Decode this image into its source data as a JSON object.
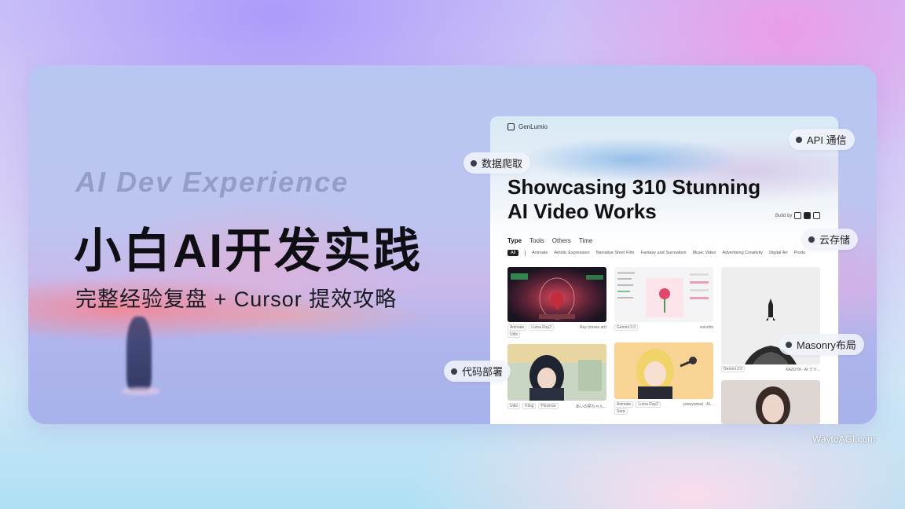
{
  "banner": {
    "eyebrow": "AI Dev Experience",
    "title": "小白AI开发实践",
    "subtitle": "完整经验复盘 + Cursor 提效攻略"
  },
  "screenshot": {
    "brand": "GenLumio",
    "title_line1": "Showcasing 310 Stunning",
    "title_line2": "AI Video Works",
    "build_by": "Build by",
    "tabs": [
      "Type",
      "Tools",
      "Others",
      "Time"
    ],
    "chips": [
      "All",
      "Animate",
      "Artistic Expression",
      "Narrative Short Film",
      "Fantasy and Surrealism",
      "Music Video",
      "Advertising Creativity",
      "Digital Art",
      "Produ"
    ],
    "cards": [
      {
        "tags": [
          "Animate",
          "Luma Ray2",
          "Udio"
        ],
        "author": "Ray (movie art)"
      },
      {
        "tags": [
          "Gemini 2.0"
        ],
        "author": "voicefm"
      },
      {
        "tags": [
          "Gemini 2.0"
        ],
        "author": "KAZUYA · AI クリ..."
      },
      {
        "tags": [
          "Udio",
          "Kling",
          "Pixverse"
        ],
        "author": "あいの夢ちゃん..."
      },
      {
        "tags": [
          "Animate",
          "Luma Ray2",
          "Sora"
        ],
        "author": "yoneyoneai · AI..."
      }
    ]
  },
  "callouts": {
    "api": "API 通信",
    "crawl": "数据爬取",
    "storage": "云存储",
    "masonry": "Masonry布局",
    "deploy": "代码部署"
  },
  "colors": {
    "title": "#0e0e14",
    "eyebrow": "#7882af",
    "accent_coral": "#fa828c",
    "pill_dot": "#3a3d4a"
  },
  "watermark": "WaytoAGI.com"
}
